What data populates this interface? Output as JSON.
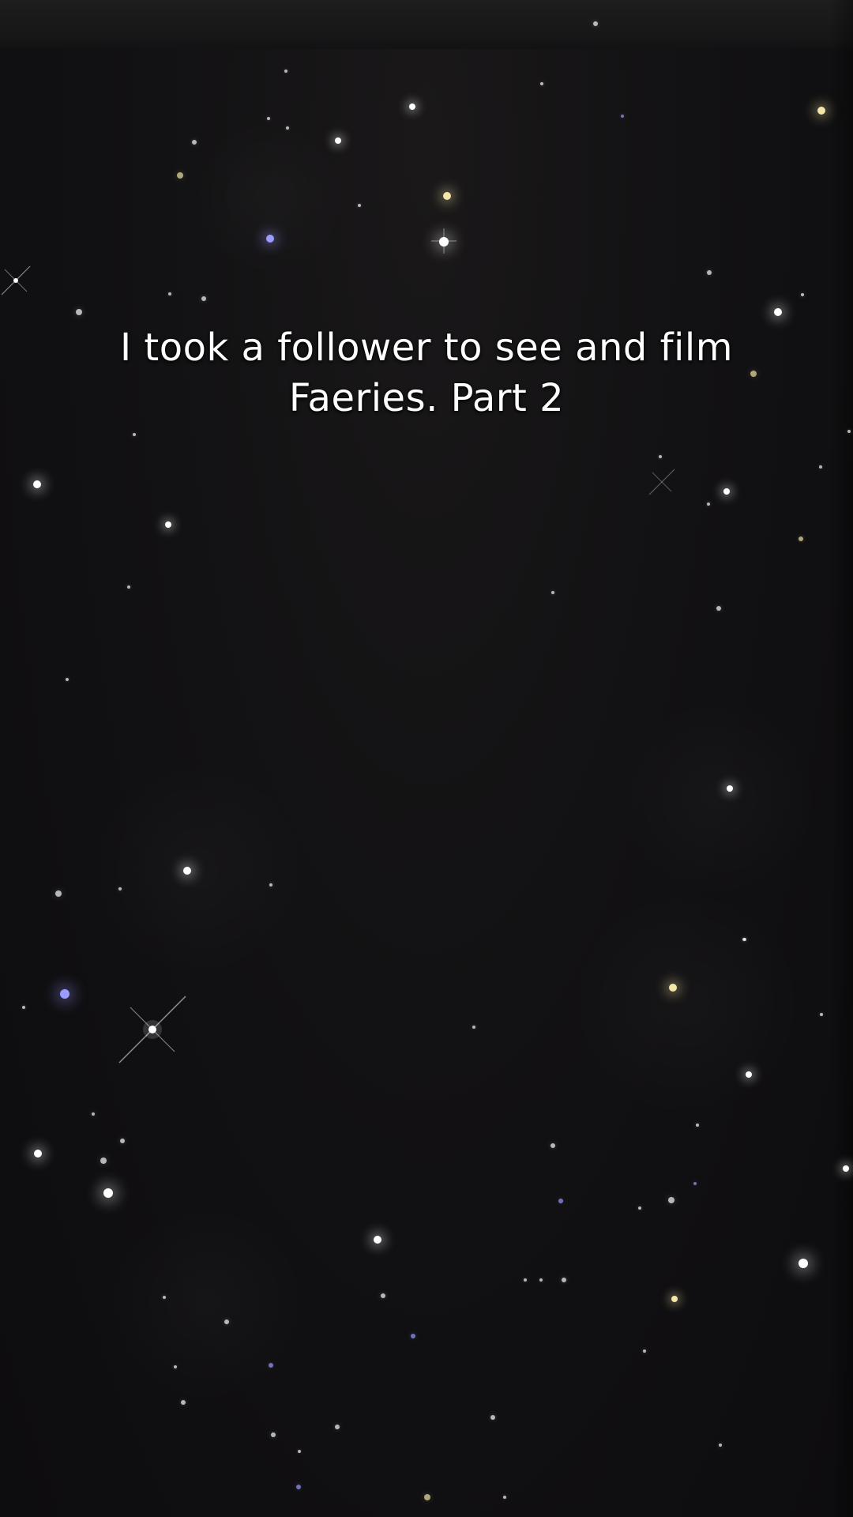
{
  "caption": {
    "line1": "I took a follower to see and film",
    "line2": "Faeries. Part 2"
  },
  "colors": {
    "background": "#0f0e10",
    "caption_text": "#ffffff",
    "star_white": "#ffffff",
    "star_warm": "#f3e6a8",
    "star_blue": "#9a9cff"
  }
}
